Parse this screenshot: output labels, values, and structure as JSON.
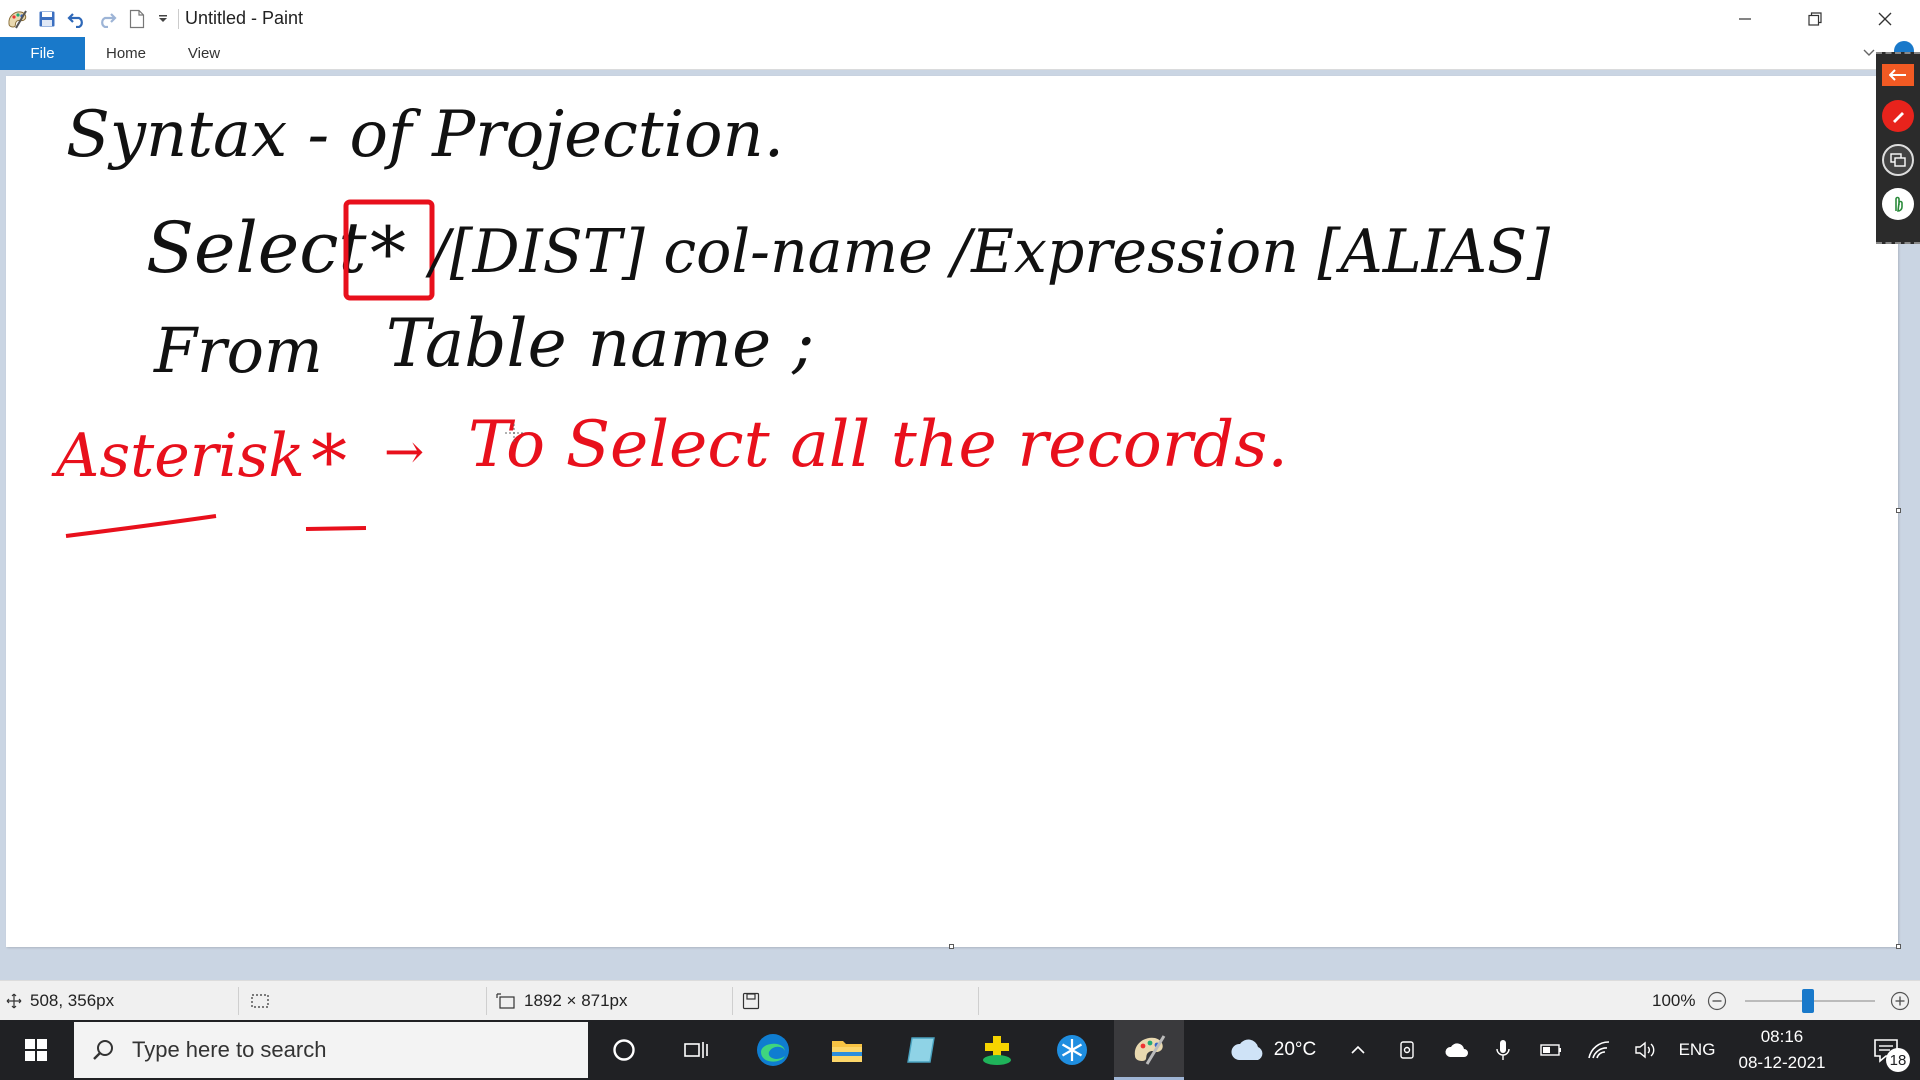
{
  "window": {
    "title": "Untitled - Paint"
  },
  "ribbon": {
    "tabs": [
      "File",
      "Home",
      "View"
    ]
  },
  "canvas_text": {
    "line1": "Syntax - of Projection.",
    "line2_select": "Select",
    "line2_star": "*",
    "line2_rest": "/[DIST] col-name /Expression [ALIAS]",
    "line3_from": "From",
    "line3_table": "Table name ;",
    "line4_asterisk": "Asterisk",
    "line4_star": "*",
    "line4_arrow": "→",
    "line4_rest": "To Select all the records."
  },
  "colors": {
    "ink_black": "#111111",
    "ink_red": "#e8101c",
    "accent": "#1979ca"
  },
  "statusbar": {
    "cursor_pos": "508, 356px",
    "selection_size": "",
    "image_size": "1892 × 871px",
    "zoom": "100%"
  },
  "taskbar": {
    "search_placeholder": "Type here to search",
    "weather": "20°C",
    "language": "ENG",
    "time": "08:16",
    "date": "08-12-2021",
    "notification_count": "18"
  }
}
